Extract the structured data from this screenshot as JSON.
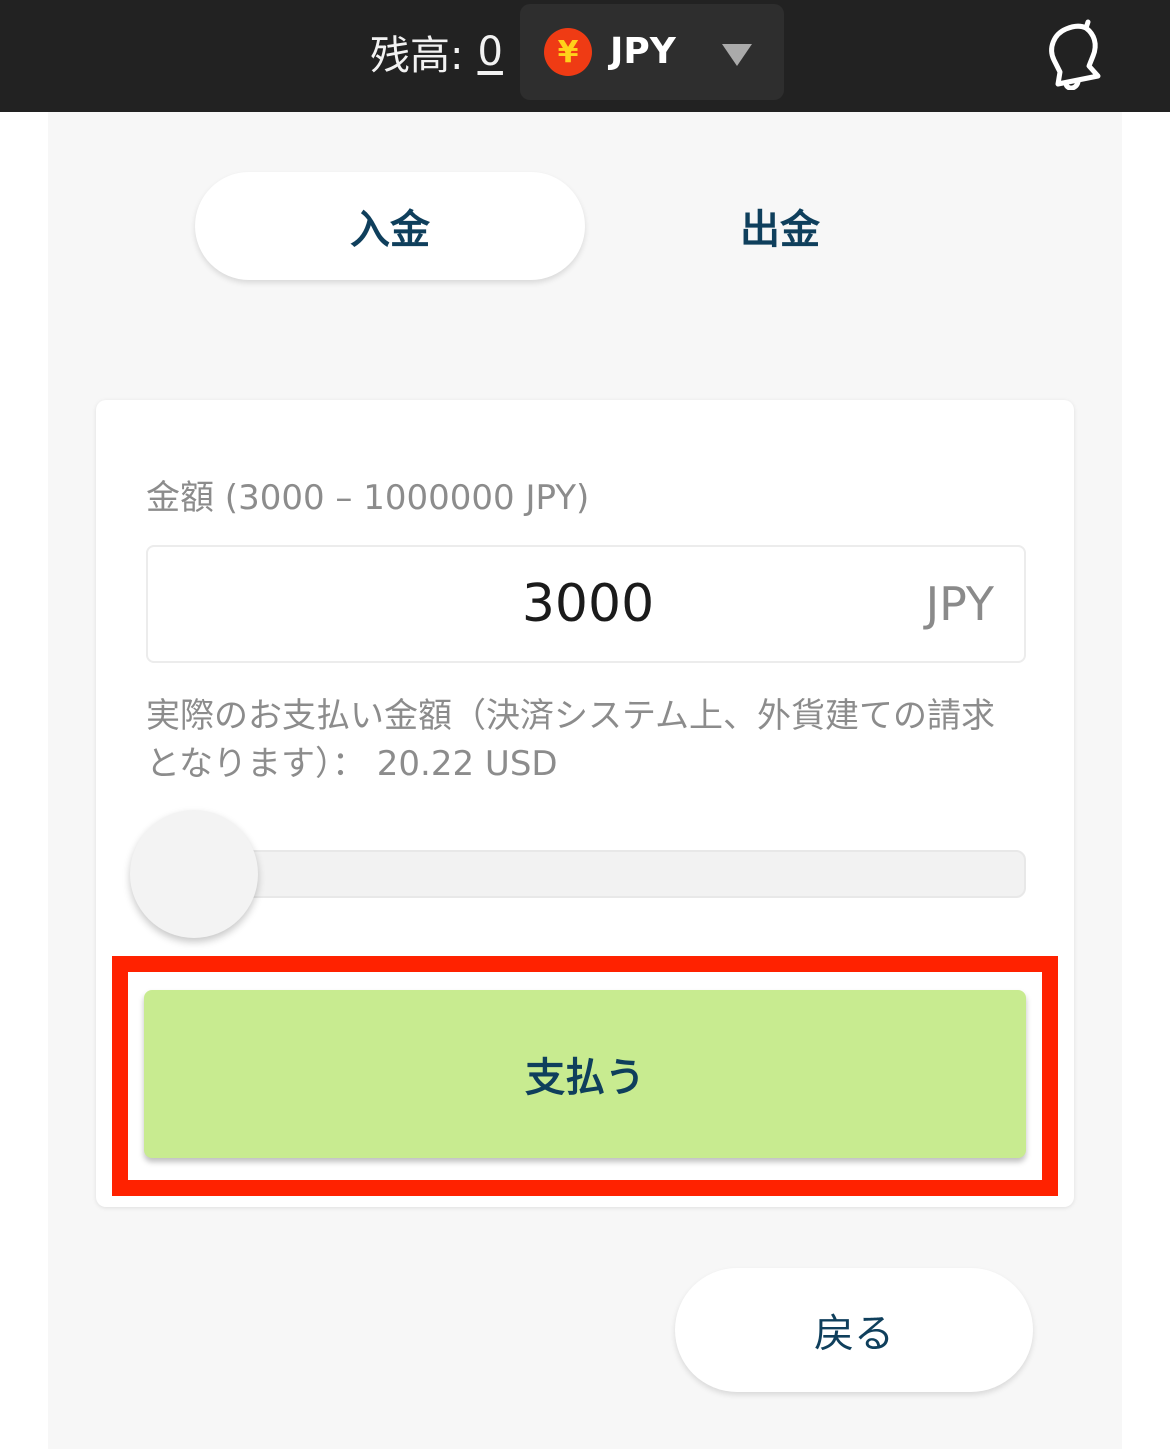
{
  "header": {
    "balance_label": "残高:",
    "balance_value": "0",
    "currency": {
      "symbol": "¥",
      "code": "JPY",
      "icon": "yen-coin-icon",
      "icon_color": "#ef3b14"
    },
    "caret_icon": "caret-down-icon",
    "notification_icon": "bell-icon"
  },
  "tabs": [
    {
      "label": "入金",
      "active": true
    },
    {
      "label": "出金",
      "active": false
    }
  ],
  "form": {
    "amount_label": "金額 (3000 – 1000000 JPY)",
    "amount_value": "3000",
    "amount_unit": "JPY",
    "note": "実際のお支払い金額（決済システム上、外貨建ての請求となります）： 20.22 USD",
    "slider_level": 0
  },
  "pay_button_label": "支払う",
  "back_button_label": "戻る",
  "colors": {
    "topbar": "#222222",
    "accent_text": "#0f3f5c",
    "pay_button": "#c8eb90",
    "highlight": "#ff2200"
  }
}
